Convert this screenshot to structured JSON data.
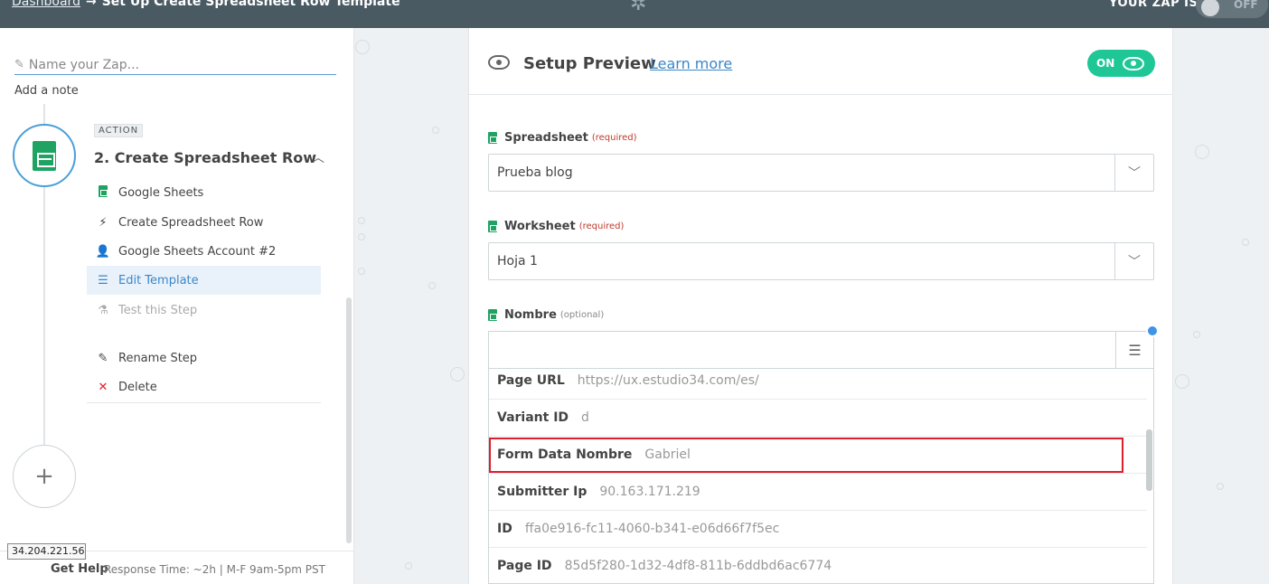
{
  "topbar": {
    "dashboard_link": "Dashboard",
    "arrow": "→",
    "page_title": "Set Up Create Spreadsheet Row Template",
    "zap_status_label": "YOUR ZAP IS",
    "zap_status_value": "OFF"
  },
  "sidebar": {
    "zap_name_placeholder": "Name your Zap...",
    "add_note": "Add a note",
    "step_badge": "ACTION",
    "step_title": "2. Create Spreadsheet Row",
    "items": [
      {
        "label": "Google Sheets",
        "icon": "google-sheets-icon"
      },
      {
        "label": "Create Spreadsheet Row",
        "icon": "bolt-icon"
      },
      {
        "label": "Google Sheets Account #2",
        "icon": "user-icon"
      },
      {
        "label": "Edit Template",
        "icon": "list-icon",
        "active": true
      },
      {
        "label": "Test this Step",
        "icon": "flask-icon",
        "disabled": true
      }
    ],
    "rename_step": "Rename Step",
    "delete": "Delete",
    "get_help": "Get Help",
    "response_time": "Response Time: ~2h | M-F 9am-5pm PST",
    "ip_tooltip": "34.204.221.56"
  },
  "card": {
    "title": "Setup Preview",
    "learn_more": "Learn more",
    "preview_toggle": "ON",
    "fields": [
      {
        "label": "Spreadsheet",
        "hint": "(required)",
        "value": "Prueba blog"
      },
      {
        "label": "Worksheet",
        "hint": "(required)",
        "value": "Hoja 1"
      },
      {
        "label": "Nombre",
        "hint": "(optional)",
        "value": ""
      }
    ],
    "dropdown_rows": [
      {
        "key": "Page URL",
        "value": "https://ux.estudio34.com/es/"
      },
      {
        "key": "Variant ID",
        "value": "d"
      },
      {
        "key": "Form Data Nombre",
        "value": "Gabriel"
      },
      {
        "key": "Submitter Ip",
        "value": "90.163.171.219"
      },
      {
        "key": "ID",
        "value": "ffa0e916-fc11-4060-b341-e06d66f7f5ec"
      },
      {
        "key": "Page ID",
        "value": "85d5f280-1d32-4df8-811b-6ddbd6ac6774"
      }
    ]
  },
  "colors": {
    "topbar": "#4a5a63",
    "accent_blue": "#3b86c8",
    "on_green": "#1fc797",
    "sheets_green": "#1ea362",
    "highlight_red": "#e01e2b"
  }
}
